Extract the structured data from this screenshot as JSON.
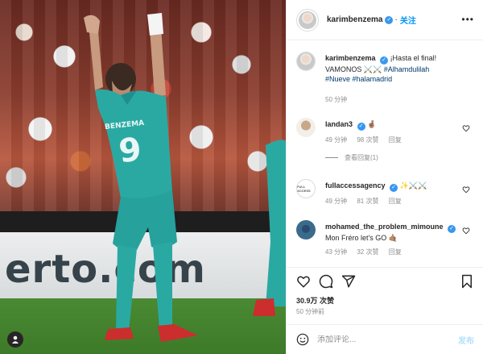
{
  "post": {
    "author": "karimbenzema",
    "follow_label": "关注",
    "caption_lines": [
      "¡Hasta el final!",
      "VAMONOS ⚔️⚔️ ",
      "#Alhamdulilah",
      "#Nueve",
      "#halamadrid"
    ],
    "caption_time": "50 分钟"
  },
  "photo": {
    "ad_text": "erto.com"
  },
  "comments": [
    {
      "user": "landan3",
      "text": "🤞🏽",
      "time": "49 分钟",
      "likes": "98 次赞",
      "reply": "回复",
      "view_replies": "查看回复(1)"
    },
    {
      "user": "fullaccessagency",
      "text": "✨⚔️⚔️",
      "time": "49 分钟",
      "likes": "81 次赞",
      "reply": "回复"
    },
    {
      "user": "mohamed_the_problem_mimoune",
      "text": "Mon Fréro let's GO 🤙🏽",
      "time": "43 分钟",
      "likes": "32 次赞",
      "reply": "回复"
    }
  ],
  "stats": {
    "likes": "30.9万 次赞",
    "posted": "50 分钟前"
  },
  "composer": {
    "placeholder": "添加评论...",
    "post_label": "发布"
  },
  "colors": {
    "accent": "#0095f6",
    "jersey": "#2aa9a3",
    "link": "#00376b"
  }
}
